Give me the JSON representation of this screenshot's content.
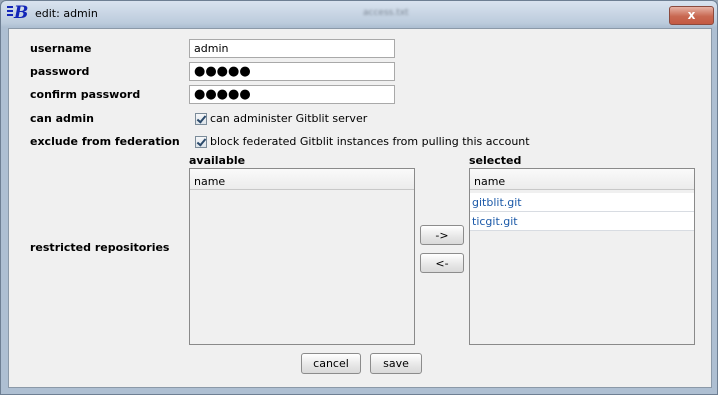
{
  "window": {
    "title": "edit: admin",
    "ghost_title": "access.txt",
    "close_label": "x",
    "logo_letter": "B"
  },
  "form": {
    "username_label": "username",
    "username_value": "admin",
    "password_label": "password",
    "password_value": "●●●●●",
    "confirm_label": "confirm password",
    "confirm_value": "●●●●●",
    "can_admin_label": "can admin",
    "can_admin_text": "can administer Gitblit server",
    "can_admin_checked": true,
    "exclude_label": "exclude from federation",
    "exclude_text": "block federated Gitblit instances from pulling this account",
    "exclude_checked": true,
    "restricted_label": "restricted repositories"
  },
  "available": {
    "title": "available",
    "column": "name",
    "items": []
  },
  "selected": {
    "title": "selected",
    "column": "name",
    "items": [
      "gitblit.git",
      "ticgit.git"
    ]
  },
  "buttons": {
    "add": "->",
    "remove": "<-",
    "cancel": "cancel",
    "save": "save"
  }
}
